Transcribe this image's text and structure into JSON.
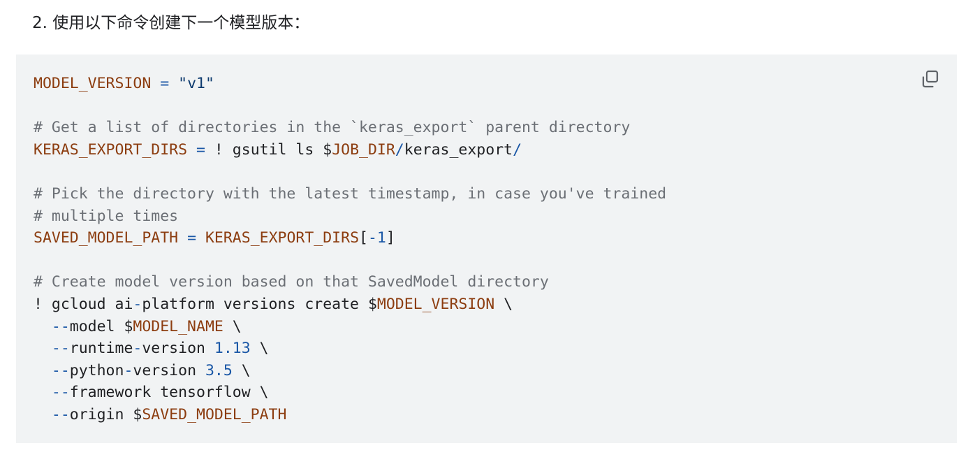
{
  "step": {
    "number": "2.",
    "text": "使用以下命令创建下一个模型版本："
  },
  "code_block": {
    "copy_icon": "copy-icon",
    "colors": {
      "background": "#f1f3f4",
      "variable": "#8c3d10",
      "string": "#0d3a6e",
      "number": "#1a57a6",
      "comment": "#6b6f75"
    },
    "lines": [
      [
        {
          "t": "MODEL_VERSION",
          "k": "var"
        },
        {
          "t": " ",
          "k": "plain"
        },
        {
          "t": "=",
          "k": "op"
        },
        {
          "t": " ",
          "k": "plain"
        },
        {
          "t": "\"v1\"",
          "k": "str"
        }
      ],
      [],
      [
        {
          "t": "# Get a list of directories in the `keras_export` parent directory",
          "k": "cmt"
        }
      ],
      [
        {
          "t": "KERAS_EXPORT_DIRS",
          "k": "var"
        },
        {
          "t": " ",
          "k": "plain"
        },
        {
          "t": "=",
          "k": "op"
        },
        {
          "t": " ! gsutil ls $",
          "k": "plain"
        },
        {
          "t": "JOB_DIR",
          "k": "var"
        },
        {
          "t": "/",
          "k": "op"
        },
        {
          "t": "keras_export",
          "k": "plain"
        },
        {
          "t": "/",
          "k": "op"
        }
      ],
      [],
      [
        {
          "t": "# Pick the directory with the latest timestamp, in case you've trained",
          "k": "cmt"
        }
      ],
      [
        {
          "t": "# multiple times",
          "k": "cmt"
        }
      ],
      [
        {
          "t": "SAVED_MODEL_PATH",
          "k": "var"
        },
        {
          "t": " ",
          "k": "plain"
        },
        {
          "t": "=",
          "k": "op"
        },
        {
          "t": " ",
          "k": "plain"
        },
        {
          "t": "KERAS_EXPORT_DIRS",
          "k": "var"
        },
        {
          "t": "[",
          "k": "plain"
        },
        {
          "t": "-1",
          "k": "num"
        },
        {
          "t": "]",
          "k": "plain"
        }
      ],
      [],
      [
        {
          "t": "# Create model version based on that SavedModel directory",
          "k": "cmt"
        }
      ],
      [
        {
          "t": "! gcloud ai",
          "k": "plain"
        },
        {
          "t": "-",
          "k": "op"
        },
        {
          "t": "platform versions create $",
          "k": "plain"
        },
        {
          "t": "MODEL_VERSION",
          "k": "var"
        },
        {
          "t": " \\",
          "k": "plain"
        }
      ],
      [
        {
          "t": "  ",
          "k": "plain"
        },
        {
          "t": "--",
          "k": "op"
        },
        {
          "t": "model $",
          "k": "plain"
        },
        {
          "t": "MODEL_NAME",
          "k": "var"
        },
        {
          "t": " \\",
          "k": "plain"
        }
      ],
      [
        {
          "t": "  ",
          "k": "plain"
        },
        {
          "t": "--",
          "k": "op"
        },
        {
          "t": "runtime",
          "k": "plain"
        },
        {
          "t": "-",
          "k": "op"
        },
        {
          "t": "version ",
          "k": "plain"
        },
        {
          "t": "1.13",
          "k": "num"
        },
        {
          "t": " \\",
          "k": "plain"
        }
      ],
      [
        {
          "t": "  ",
          "k": "plain"
        },
        {
          "t": "--",
          "k": "op"
        },
        {
          "t": "python",
          "k": "plain"
        },
        {
          "t": "-",
          "k": "op"
        },
        {
          "t": "version ",
          "k": "plain"
        },
        {
          "t": "3.5",
          "k": "num"
        },
        {
          "t": " \\",
          "k": "plain"
        }
      ],
      [
        {
          "t": "  ",
          "k": "plain"
        },
        {
          "t": "--",
          "k": "op"
        },
        {
          "t": "framework tensorflow \\",
          "k": "plain"
        }
      ],
      [
        {
          "t": "  ",
          "k": "plain"
        },
        {
          "t": "--",
          "k": "op"
        },
        {
          "t": "origin $",
          "k": "plain"
        },
        {
          "t": "SAVED_MODEL_PATH",
          "k": "var"
        }
      ]
    ]
  }
}
